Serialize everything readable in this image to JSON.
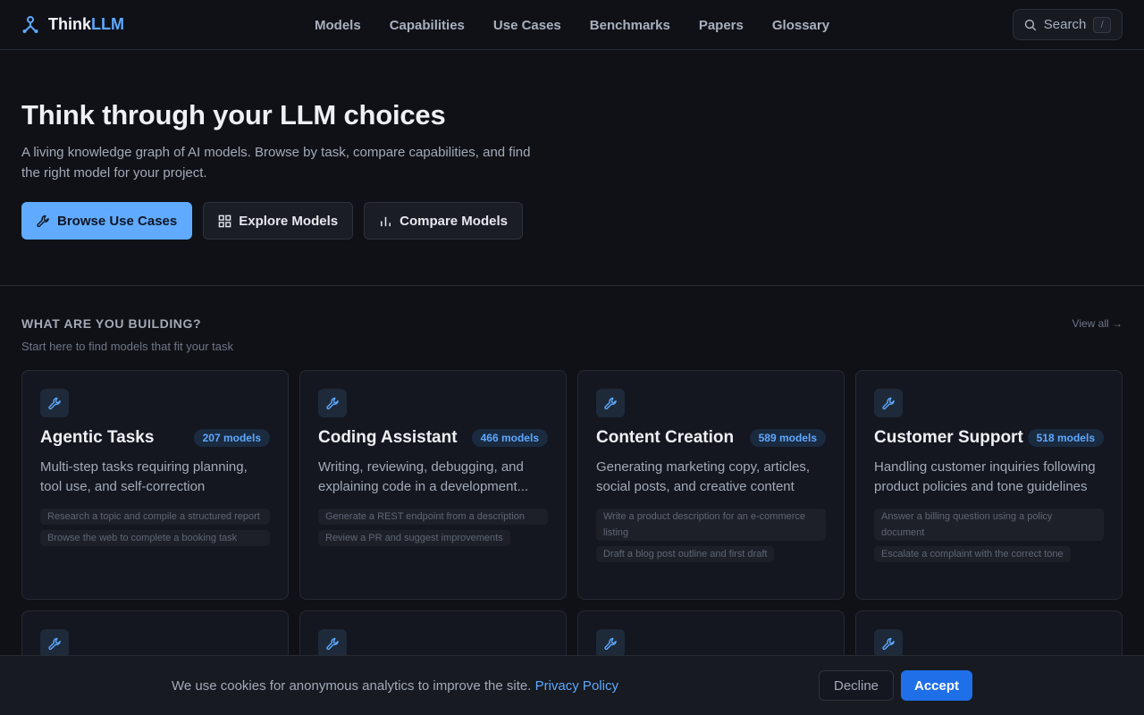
{
  "brand": {
    "think": "Think",
    "llm": "LLM"
  },
  "nav": [
    "Models",
    "Capabilities",
    "Use Cases",
    "Benchmarks",
    "Papers",
    "Glossary"
  ],
  "search": {
    "label": "Search",
    "shortcut": "/"
  },
  "hero": {
    "title": "Think through your LLM choices",
    "subtitle": "A living knowledge graph of AI models. Browse by task, compare capabilities, and find the right model for your project.",
    "buttons": {
      "browse": "Browse Use Cases",
      "explore": "Explore Models",
      "compare": "Compare Models"
    }
  },
  "section": {
    "title": "WHAT ARE YOU BUILDING?",
    "subtitle": "Start here to find models that fit your task",
    "view_all": "View all →"
  },
  "cards": [
    {
      "title": "Agentic Tasks",
      "count": "207 models",
      "desc": "Multi-step tasks requiring planning, tool use, and self-correction",
      "examples": [
        "Research a topic and compile a structured report",
        "Browse the web to complete a booking task"
      ]
    },
    {
      "title": "Coding Assistant",
      "count": "466 models",
      "desc": "Writing, reviewing, debugging, and explaining code in a development...",
      "examples": [
        "Generate a REST endpoint from a description",
        "Review a PR and suggest improvements"
      ]
    },
    {
      "title": "Content Creation",
      "count": "589 models",
      "desc": "Generating marketing copy, articles, social posts, and creative content",
      "examples": [
        "Write a product description for an e-commerce listing",
        "Draft a blog post outline and first draft"
      ]
    },
    {
      "title": "Customer Support",
      "count": "518 models",
      "desc": "Handling customer inquiries following product policies and tone guidelines",
      "examples": [
        "Answer a billing question using a policy document",
        "Escalate a complaint with the correct tone"
      ]
    }
  ],
  "cookie": {
    "message": "We use cookies for anonymous analytics to improve the site.",
    "link": "Privacy Policy",
    "decline": "Decline",
    "accept": "Accept"
  },
  "colors": {
    "accent": "#5ea8ff",
    "accept": "#1f6fe8",
    "background": "#0f1117"
  }
}
